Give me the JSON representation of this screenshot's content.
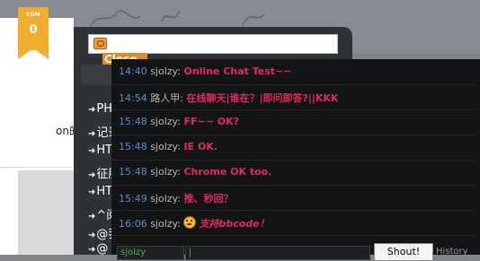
{
  "badge": {
    "small_text": "COM",
    "count": "0"
  },
  "left_text": "on的self查",
  "popup": {
    "close_label": "Close",
    "close_icon_glyph": "✕"
  },
  "nav": {
    "items": [
      {
        "label": "PH",
        "icon": "arrow-icon"
      },
      {
        "label": "记录",
        "icon": "arrow-icon"
      },
      {
        "label": "HT",
        "icon": "arrow-icon"
      },
      {
        "label": "征服",
        "icon": "arrow-icon"
      },
      {
        "label": "HT",
        "icon": "arrow-icon"
      },
      {
        "label": "^阅",
        "icon": "arrow-icon"
      },
      {
        "label": "@我",
        "icon": "arrow-icon"
      },
      {
        "label": "@",
        "icon": "arrow-icon"
      }
    ]
  },
  "chat": {
    "messages": [
      {
        "time": "14:40",
        "user": "sjolzy:",
        "text": "Online Chat Test~~"
      },
      {
        "time": "14:54",
        "user": "路人甲:",
        "text": "在线聊天|谁在？|即问即答?||KKK"
      },
      {
        "time": "15:48",
        "user": "sjolzy:",
        "text": "FF~~ OK?"
      },
      {
        "time": "15:48",
        "user": "sjolzy:",
        "text": "IE OK."
      },
      {
        "time": "15:48",
        "user": "sjolzy:",
        "text": "Chrome OK too."
      },
      {
        "time": "15:49",
        "user": "sjolzy:",
        "text": "推、秒回？"
      },
      {
        "time": "16:06",
        "user": "sjolzy:",
        "text": "支持bbcode！",
        "emoji": "angry-face-icon"
      }
    ],
    "name_value": "sjolzy",
    "shout_label": "Shout!",
    "history_label": "History"
  },
  "colors": {
    "accent_orange": "#e48a1e",
    "badge_orange": "#f0ad2f",
    "message_text": "#e02b5a",
    "time_text": "#5b8cc9",
    "chat_bg": "#121416",
    "panel_bg": "#2f3337"
  }
}
